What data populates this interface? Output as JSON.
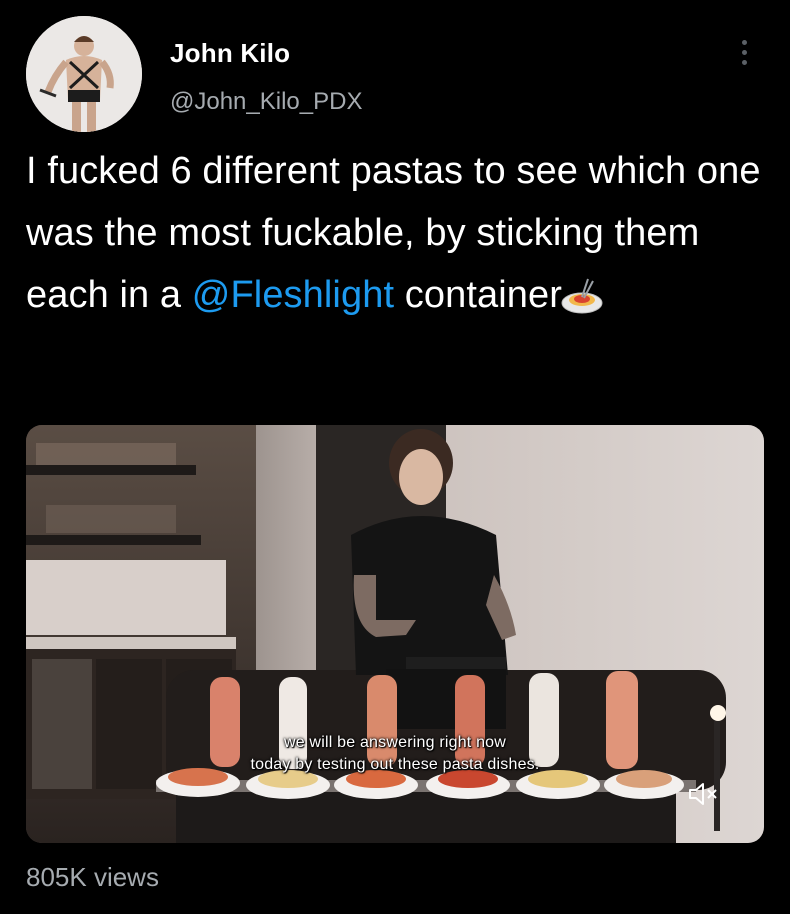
{
  "author": {
    "name": "John Kilo",
    "handle": "@John_Kilo_PDX"
  },
  "tweet": {
    "text_before": "I fucked 6 different pastas to see which one was the most fuckable, by sticking them each in a ",
    "mention": "@Fleshlight",
    "text_after": " container",
    "emoji": "spaghetti-emoji"
  },
  "video": {
    "subtitle_line1": "we will be answering right now",
    "subtitle_line2": "today by testing out these pasta dishes.",
    "muted": true
  },
  "stats": {
    "views": "805K views"
  },
  "colors": {
    "background": "#000000",
    "text": "#ffffff",
    "secondary": "#a6abb0",
    "link": "#1d9bf0"
  }
}
